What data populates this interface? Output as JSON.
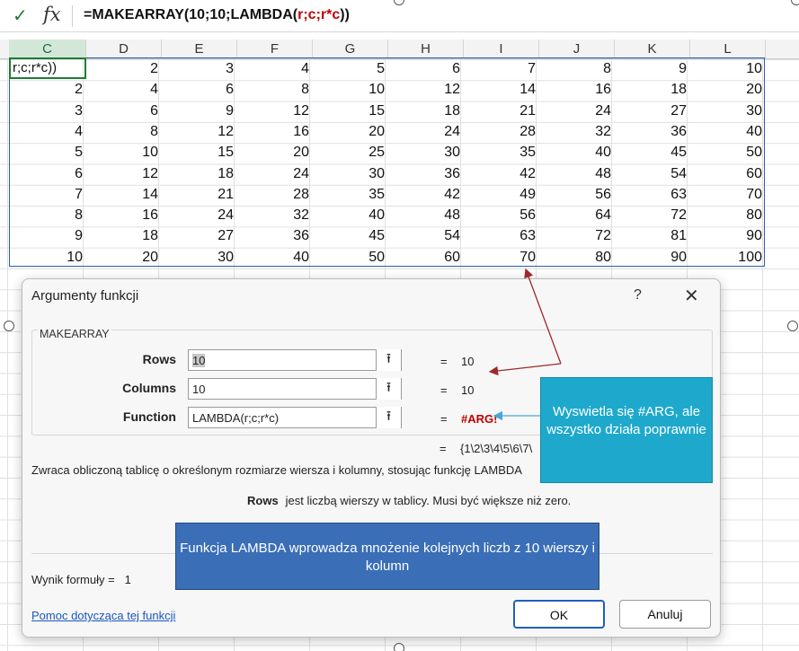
{
  "formula_bar": {
    "check_icon": "checkmark-icon",
    "fx_label": "fx",
    "formula_prefix": "=MAKEARRAY(10;10;LAMBDA(",
    "formula_red": "r;c;r*c",
    "formula_suffix": "))"
  },
  "columns": [
    "C",
    "D",
    "E",
    "F",
    "G",
    "H",
    "I",
    "J",
    "K",
    "L"
  ],
  "active_cell_text": "r;c;r*c))",
  "grid_rows": [
    [
      "",
      "2",
      "3",
      "4",
      "5",
      "6",
      "7",
      "8",
      "9",
      "10"
    ],
    [
      "2",
      "4",
      "6",
      "8",
      "10",
      "12",
      "14",
      "16",
      "18",
      "20"
    ],
    [
      "3",
      "6",
      "9",
      "12",
      "15",
      "18",
      "21",
      "24",
      "27",
      "30"
    ],
    [
      "4",
      "8",
      "12",
      "16",
      "20",
      "24",
      "28",
      "32",
      "36",
      "40"
    ],
    [
      "5",
      "10",
      "15",
      "20",
      "25",
      "30",
      "35",
      "40",
      "45",
      "50"
    ],
    [
      "6",
      "12",
      "18",
      "24",
      "30",
      "36",
      "42",
      "48",
      "54",
      "60"
    ],
    [
      "7",
      "14",
      "21",
      "28",
      "35",
      "42",
      "49",
      "56",
      "63",
      "70"
    ],
    [
      "8",
      "16",
      "24",
      "32",
      "40",
      "48",
      "56",
      "64",
      "72",
      "80"
    ],
    [
      "9",
      "18",
      "27",
      "36",
      "45",
      "54",
      "63",
      "72",
      "81",
      "90"
    ],
    [
      "10",
      "20",
      "30",
      "40",
      "50",
      "60",
      "70",
      "80",
      "90",
      "100"
    ]
  ],
  "dialog": {
    "title": "Argumenty funkcji",
    "help_label": "?",
    "close_label": "✕",
    "function_name": "MAKEARRAY",
    "args": [
      {
        "label": "Rows",
        "value": "10",
        "result": "10"
      },
      {
        "label": "Columns",
        "value": "10",
        "result": "10"
      },
      {
        "label": "Function",
        "value": "LAMBDA(r;c;r*c)",
        "result": "#ARG!"
      }
    ],
    "equals": "=",
    "total_result": "{1\\2\\3\\4\\5\\6\\7\\",
    "description": "Zwraca obliczoną tablicę o określonym rozmiarze wiersza i kolumny, stosując funkcję LAMBDA",
    "arg_desc_name": "Rows",
    "arg_desc_text": "jest liczbą wierszy w tablicy.  Musi być większe niż zero.",
    "formula_result_label": "Wynik formuły =",
    "formula_result_value": "1",
    "help_link": "Pomoc dotycząca tej funkcji",
    "ok_label": "OK",
    "cancel_label": "Anuluj"
  },
  "callouts": {
    "teal": "Wyswietla się #ARG, ale wszystko działa poprawnie",
    "blue": "Funkcja LAMBDA wprowadza mnożenie kolejnych liczb z 10 wierszy i kolumn"
  },
  "colors": {
    "accent_green": "#1e7b34",
    "selection_blue": "#2e5bb0",
    "error_red": "#c00000",
    "callout_teal": "#1ea9cc",
    "callout_blue": "#3a6eb7",
    "arrow_red": "#a0282a"
  }
}
